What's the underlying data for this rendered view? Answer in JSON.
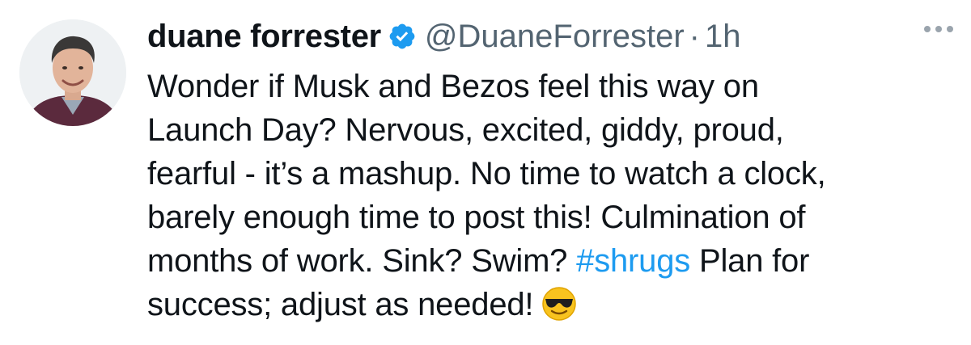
{
  "tweet": {
    "display_name": "duane forrester",
    "handle": "@DuaneForrester",
    "separator": "·",
    "time": "1h",
    "text_lines": [
      "Wonder if Musk and Bezos feel this way on",
      "Launch Day? Nervous, excited, giddy, proud,",
      "fearful - it’s a mashup. No time to watch a clock,",
      "barely enough time to post this! Culmination of"
    ],
    "line5_before": "months of work. Sink? Swim? ",
    "hashtag": "#shrugs",
    "line5_after": " Plan for",
    "line6": "success; adjust as needed!",
    "emoji": "sunglasses-face",
    "verified_badge": "verified-icon",
    "colors": {
      "hashtag": "#1d9bf0",
      "verified": "#1d9bf0",
      "secondary_text": "#536471"
    }
  }
}
